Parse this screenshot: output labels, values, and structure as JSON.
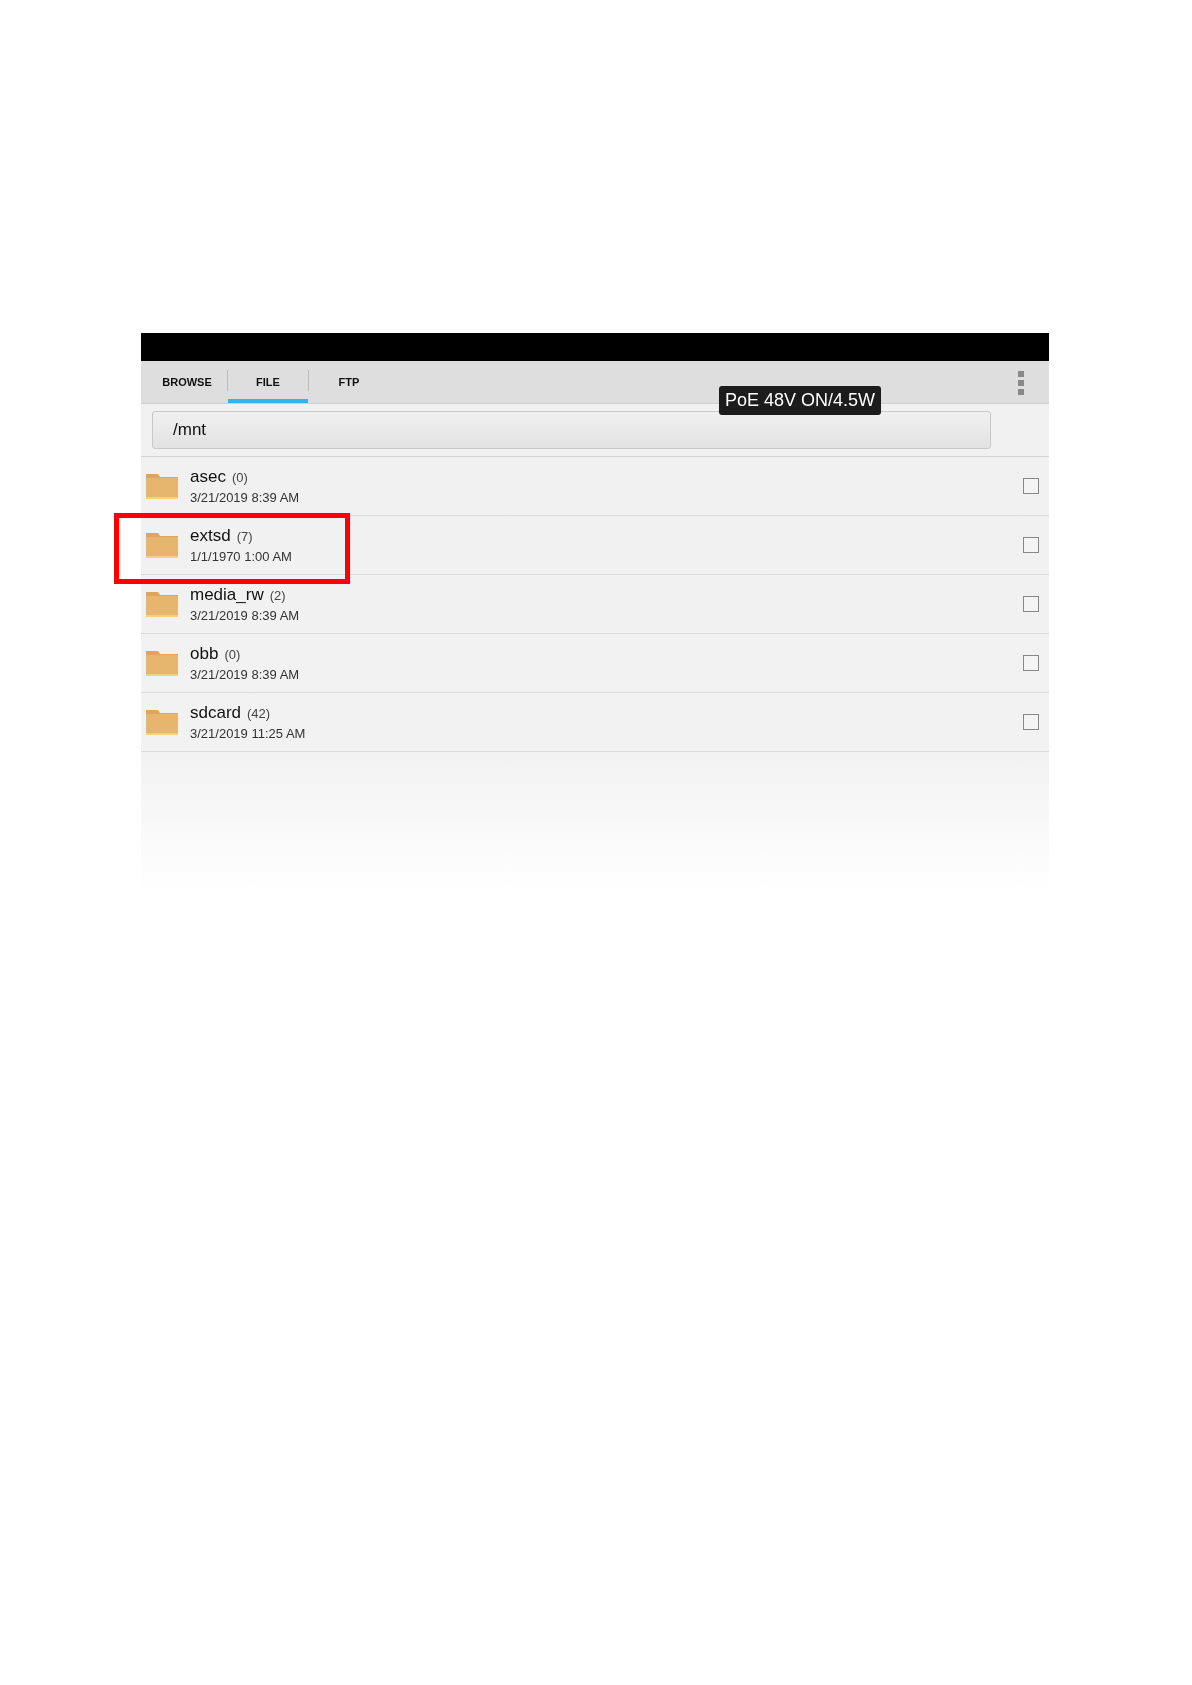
{
  "tabs": [
    {
      "label": "BROWSE",
      "selected": false
    },
    {
      "label": "FILE",
      "selected": true
    },
    {
      "label": "FTP",
      "selected": false
    }
  ],
  "path": "/mnt",
  "tooltip": "PoE 48V ON/4.5W",
  "items": [
    {
      "name": "asec",
      "count": "(0)",
      "date": "3/21/2019 8:39 AM",
      "checked": false,
      "highlighted": false
    },
    {
      "name": "extsd",
      "count": "(7)",
      "date": "1/1/1970 1:00 AM",
      "checked": false,
      "highlighted": true
    },
    {
      "name": "media_rw",
      "count": "(2)",
      "date": "3/21/2019 8:39 AM",
      "checked": false,
      "highlighted": false
    },
    {
      "name": "obb",
      "count": "(0)",
      "date": "3/21/2019 8:39 AM",
      "checked": false,
      "highlighted": false
    },
    {
      "name": "sdcard",
      "count": "(42)",
      "date": "3/21/2019 11:25 AM",
      "checked": false,
      "highlighted": false
    }
  ]
}
